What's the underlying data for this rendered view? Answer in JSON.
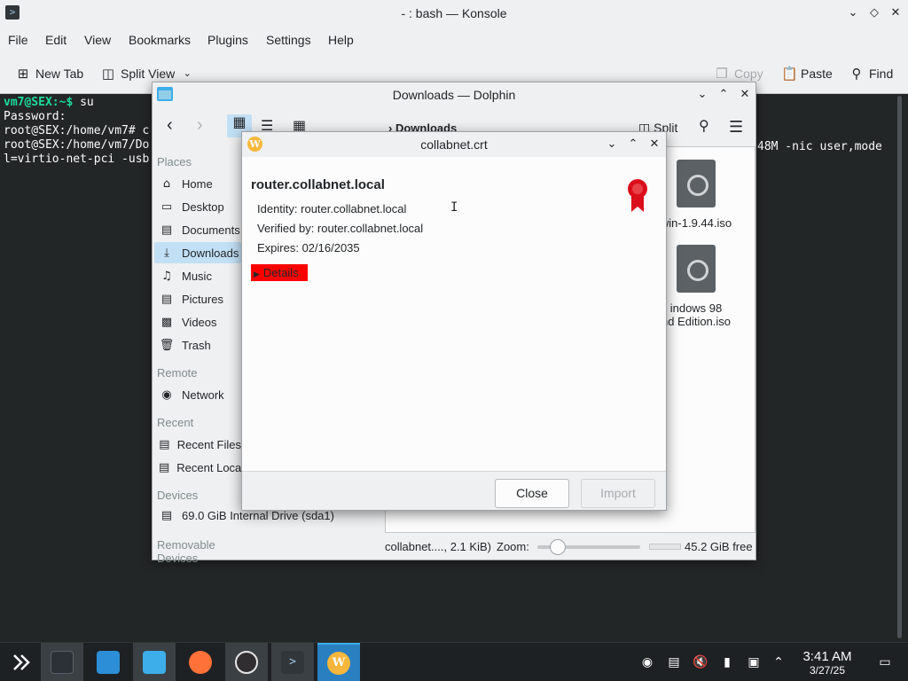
{
  "konsole": {
    "title": "- : bash — Konsole",
    "menu": [
      "File",
      "Edit",
      "View",
      "Bookmarks",
      "Plugins",
      "Settings",
      "Help"
    ],
    "toolbar": {
      "new_tab": "New Tab",
      "split_view": "Split View",
      "copy": "Copy",
      "paste": "Paste",
      "find": "Find"
    },
    "terminal": {
      "line1_prompt": "vm7@SEX:~$",
      "line1_cmd": " su",
      "line2": "Password:",
      "line3": "root@SEX:/home/vm7# c",
      "line4": "root@SEX:/home/vm7/Do",
      "line5": "l=virtio-net-pci -usb",
      "right_fragment_1": "48M -nic user,mode"
    }
  },
  "dolphin": {
    "title": "Downloads — Dolphin",
    "breadcrumb": "Downloads",
    "split_label": "Split",
    "places_header": "Places",
    "places": [
      "Home",
      "Desktop",
      "Documents",
      "Downloads",
      "Music",
      "Pictures",
      "Videos",
      "Trash"
    ],
    "remote_header": "Remote",
    "remote": [
      "Network"
    ],
    "recent_header": "Recent",
    "recent": [
      "Recent Files",
      "Recent Locations"
    ],
    "devices_header": "Devices",
    "devices": [
      "69.0 GiB Internal Drive (sda1)"
    ],
    "removable_header": "Removable Devices",
    "files": [
      "win-1.9.44.iso",
      "indows 98",
      "nd Edition.iso"
    ],
    "status": {
      "file": "collabnet...., 2.1 KiB)",
      "zoom_label": "Zoom:",
      "free": "45.2 GiB free",
      "zoom_level": 0.2
    }
  },
  "certificate_dialog": {
    "title": "collabnet.crt",
    "host": "router.collabnet.local",
    "identity": "Identity: router.collabnet.local",
    "verified_by": "Verified by: router.collabnet.local",
    "expires": "Expires: 02/16/2035",
    "details_label": "Details",
    "close_label": "Close",
    "import_label": "Import",
    "accent_color": "#ff0000",
    "seal_color": "#da0e1a"
  },
  "taskbar": {
    "time": "3:41 AM",
    "date": "3/27/25"
  }
}
